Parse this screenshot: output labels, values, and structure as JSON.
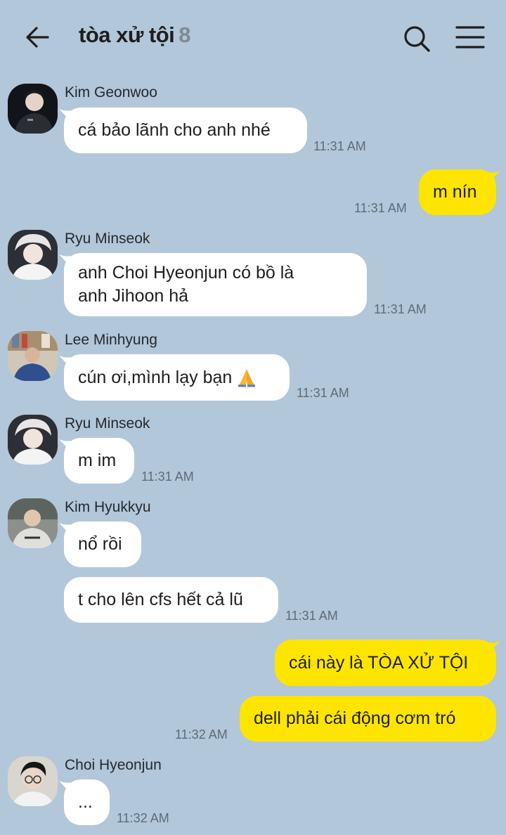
{
  "header": {
    "title": "tòa xử tội",
    "member_count": "8",
    "icons": {
      "back": "arrow-left-icon",
      "search": "search-icon",
      "menu": "hamburger-menu-icon"
    }
  },
  "colors": {
    "background": "#b2c7d9",
    "my_bubble": "#fee500",
    "other_bubble": "#ffffff",
    "member_count": "#7f8a94"
  },
  "messages": [
    {
      "sender": "Kim Geonwoo",
      "text": "cá bảo lãnh cho anh nhé",
      "time": "11:31 AM"
    },
    {
      "sender": "me",
      "text": "m nín",
      "time": "11:31 AM"
    },
    {
      "sender": "Ryu Minseok",
      "line1": "anh Choi Hyeonjun có bồ là",
      "line2": "anh Jihoon hả",
      "time": "11:31 AM"
    },
    {
      "sender": "Lee Minhyung",
      "text": "cún ơi,mình lạy bạn",
      "emoji": "folded-hands-emoji",
      "time": "11:31 AM"
    },
    {
      "sender": "Ryu Minseok",
      "text": "m im",
      "time": "11:31 AM"
    },
    {
      "sender": "Kim Hyukkyu",
      "text": "nổ rồi"
    },
    {
      "sender": "Kim Hyukkyu",
      "text": "t cho lên cfs hết cả lũ",
      "time": "11:31 AM"
    },
    {
      "sender": "me",
      "text": "cái này là TÒA XỬ TỘI"
    },
    {
      "sender": "me",
      "text": "dell phải cái động cơm tró",
      "time": "11:32 AM"
    },
    {
      "sender": "Choi Hyeonjun",
      "text": "...",
      "time": "11:32 AM"
    }
  ]
}
